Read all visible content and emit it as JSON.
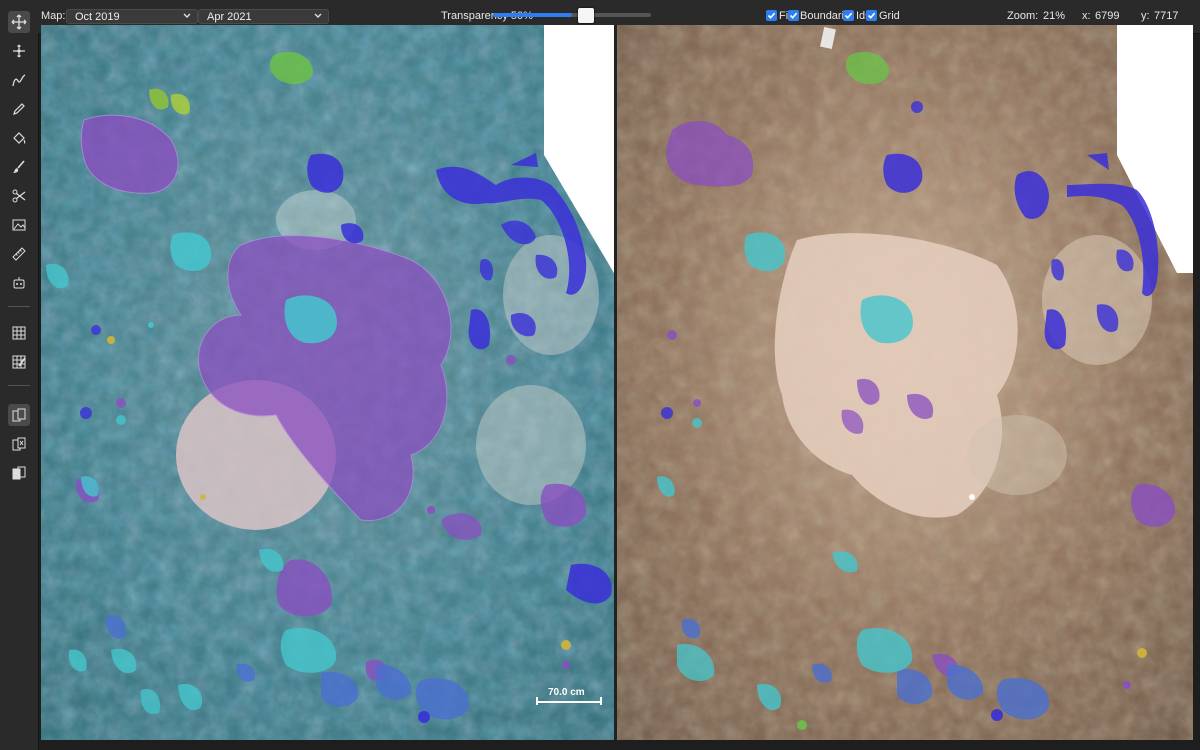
{
  "topbar": {
    "map_label": "Map:",
    "map_left_date": "Oct 2019",
    "map_right_date": "Apr 2021",
    "transparency_label": "Transparency 50%",
    "transparency_value": 0.5,
    "fill_label": "Fi",
    "boundaries_label": "Boundaries",
    "ids_label": "Ids",
    "grid_label": "Grid",
    "zoom_label": "Zoom:",
    "zoom_value": "21%",
    "x_label": "x:",
    "x_value": "6799",
    "y_label": "y:",
    "y_value": "7717"
  },
  "map": {
    "scale_bar_label": "70.0 cm"
  },
  "colors": {
    "accent": "#2e7ef0",
    "purple_region": "#8a4fc0",
    "blue_region": "#3a2fd8",
    "cyan_region": "#45c6cc",
    "green_region": "#6cc04a"
  },
  "tools": [
    "move-icon",
    "pan-icon",
    "freehand-icon",
    "pencil-icon",
    "fill-icon",
    "brush-icon",
    "scissors-icon",
    "image-icon",
    "ruler-icon",
    "robot-icon",
    "grid-icon",
    "grid-edit-icon",
    "split-view-icon",
    "compare-icon",
    "overlay-icon"
  ]
}
